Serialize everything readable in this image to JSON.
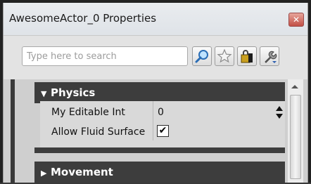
{
  "window": {
    "title": "AwesomeActor_0 Properties",
    "close_glyph": "✕"
  },
  "toolbar": {
    "search_placeholder": "Type here to search",
    "buttons": [
      "search-icon",
      "star-icon",
      "lock-icon",
      "wrench-options-icon"
    ]
  },
  "categories": [
    {
      "label": "Physics",
      "expanded": true,
      "arrow": "▼",
      "properties": [
        {
          "label": "My Editable Int",
          "value": "0",
          "type": "int"
        },
        {
          "label": "Allow Fluid Surface",
          "value": "✔",
          "type": "bool",
          "checked": true
        }
      ]
    },
    {
      "label": "Movement",
      "expanded": false,
      "arrow": "▶"
    }
  ],
  "colors": {
    "category_bg": "#3d3d3d",
    "title_bg": "#e6e9ed",
    "close_red": "#c24f45"
  }
}
